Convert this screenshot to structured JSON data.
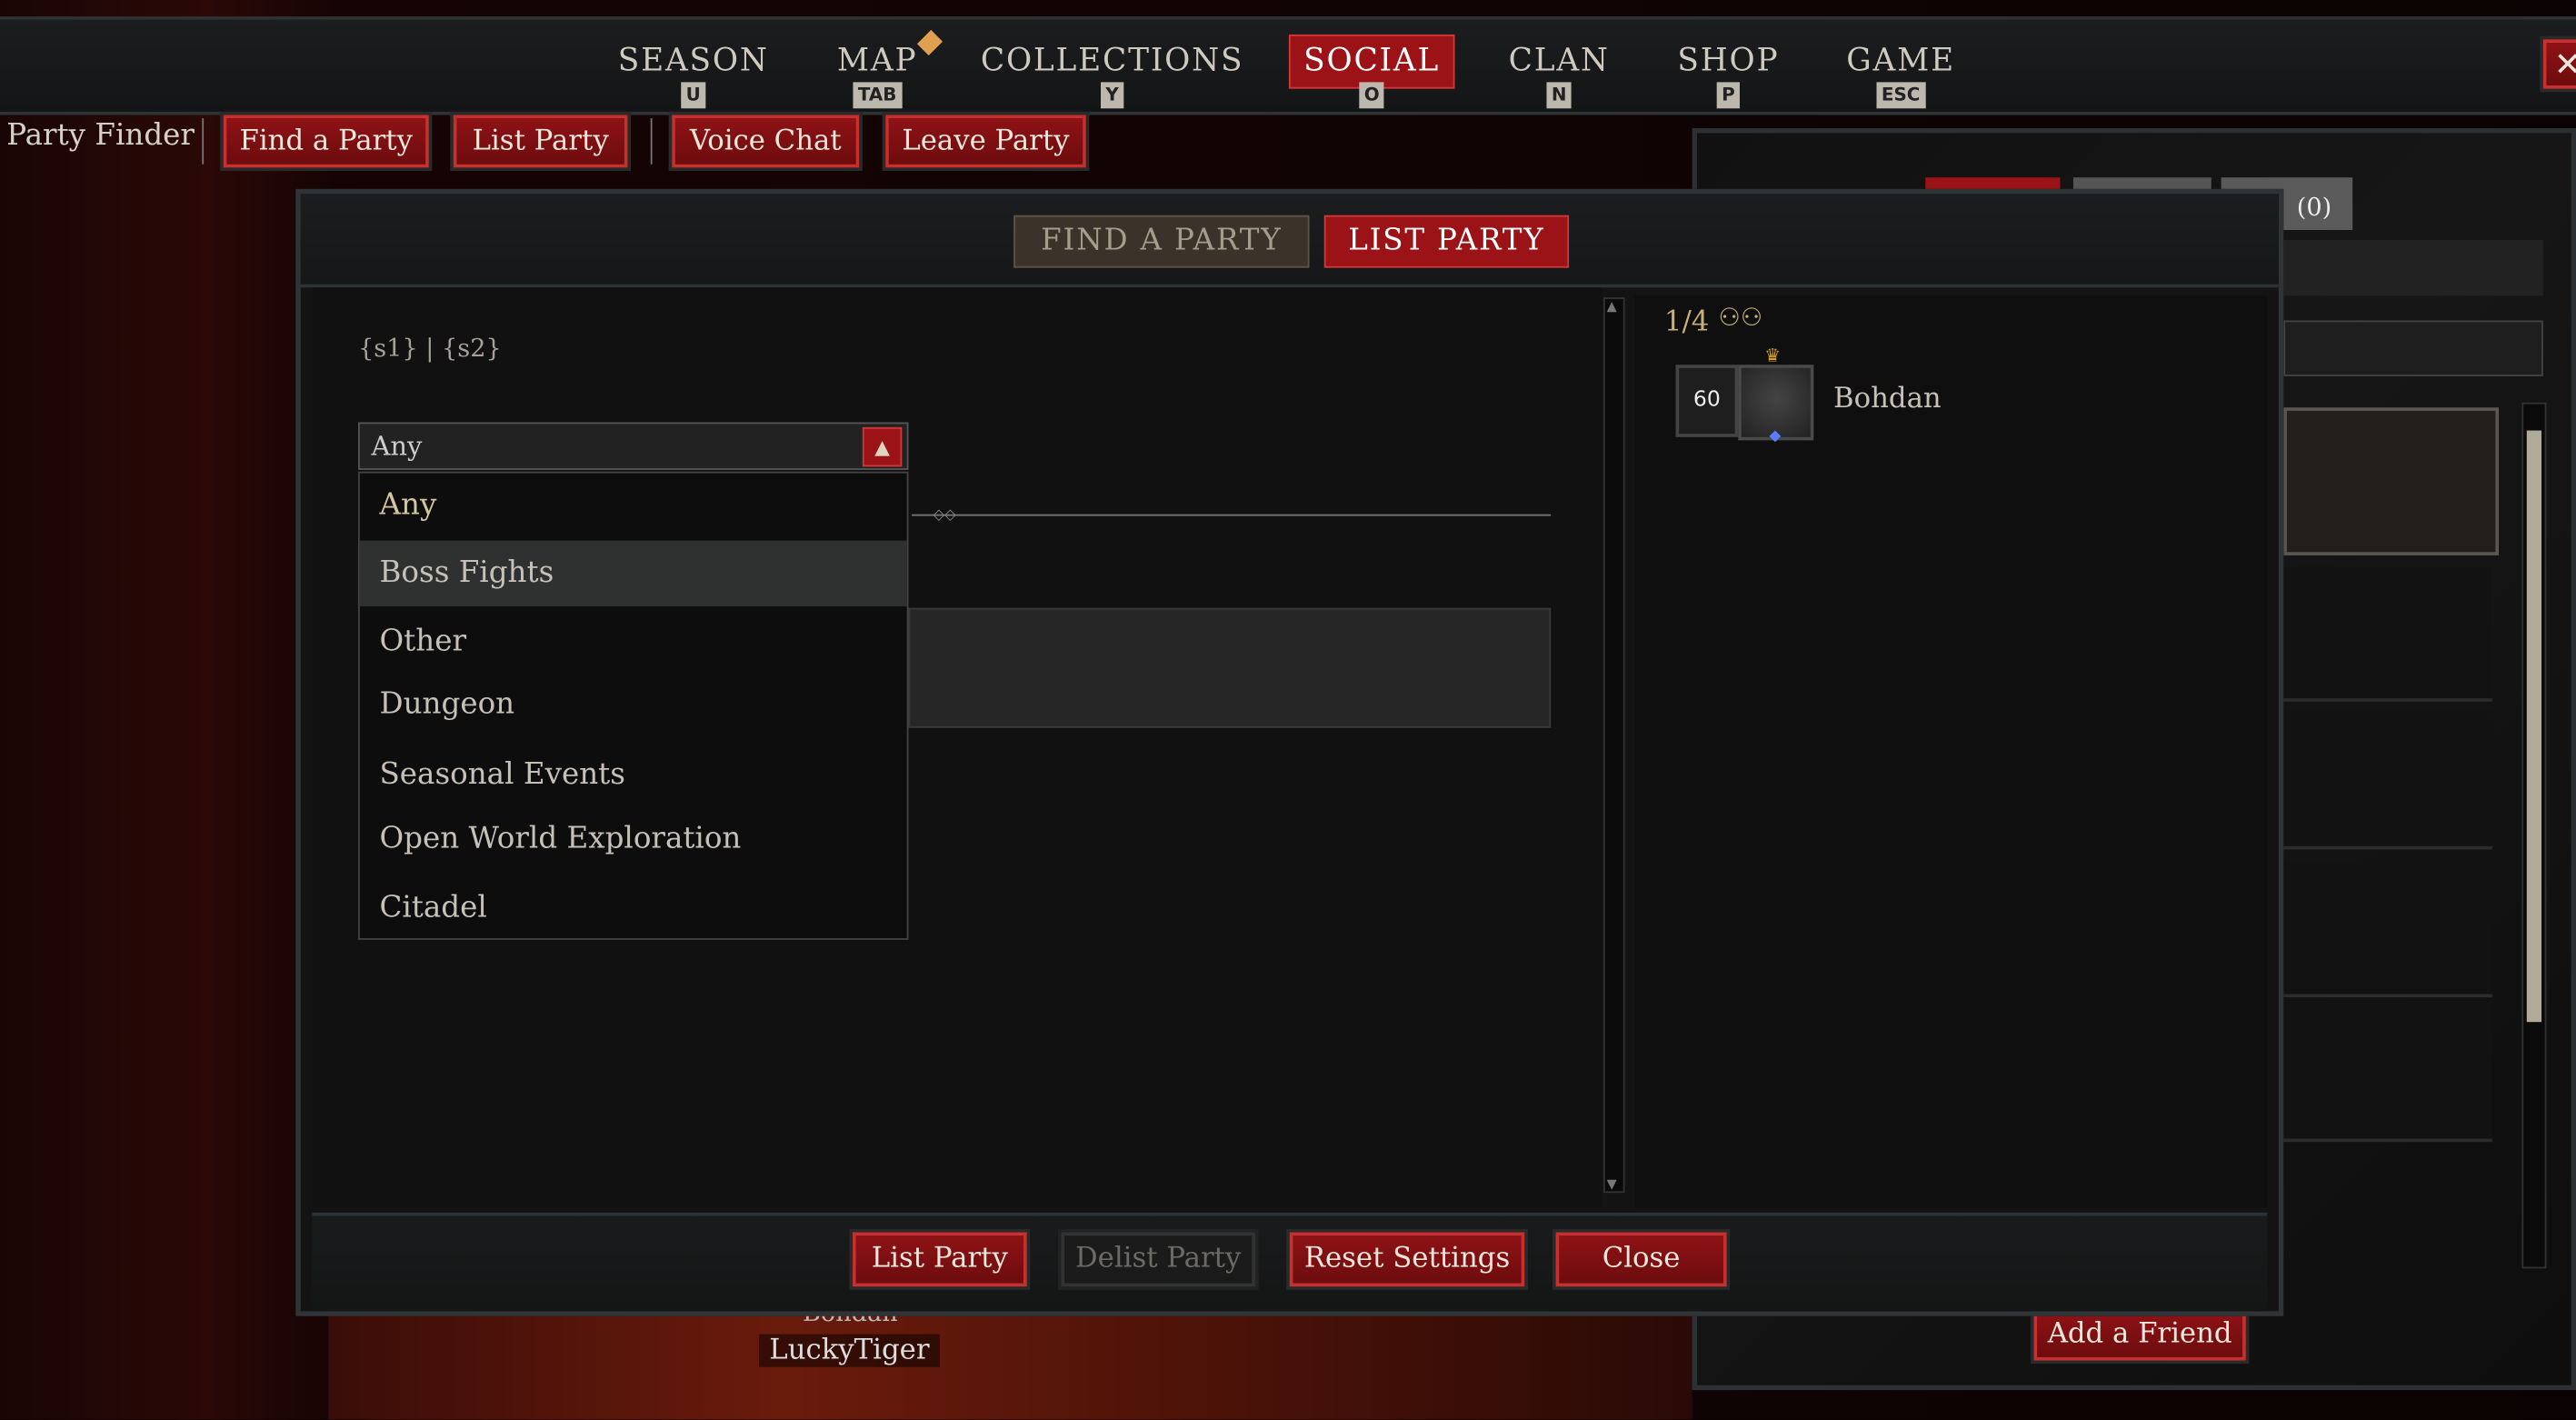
{
  "nav": {
    "items": [
      {
        "label": "SEASON",
        "key": "U"
      },
      {
        "label": "MAP",
        "key": "TAB"
      },
      {
        "label": "COLLECTIONS",
        "key": "Y"
      },
      {
        "label": "SOCIAL",
        "key": "O",
        "active": true
      },
      {
        "label": "CLAN",
        "key": "N"
      },
      {
        "label": "SHOP",
        "key": "P"
      },
      {
        "label": "GAME",
        "key": "ESC"
      }
    ],
    "close_icon": "close-x-icon"
  },
  "subbar": {
    "title": "Party Finder",
    "buttons": [
      "Find a Party",
      "List Party",
      "Voice Chat",
      "Leave Party"
    ]
  },
  "dialog": {
    "tabs": [
      {
        "label": "FIND A PARTY",
        "active": false
      },
      {
        "label": "LIST PARTY",
        "active": true
      }
    ],
    "placeholder_text": "{s1} | {s2}",
    "activity_select": {
      "value": "Any",
      "options": [
        "Any",
        "Boss Fights",
        "Other",
        "Dungeon",
        "Seasonal Events",
        "Open World Exploration",
        "Citadel"
      ],
      "highlighted": "Boss Fights"
    },
    "party": {
      "count": "1/4",
      "members": [
        {
          "level": "60",
          "name": "Bohdan",
          "leader": true
        }
      ]
    },
    "footer": {
      "list": "List Party",
      "delist": "Delist Party",
      "reset": "Reset Settings",
      "close": "Close"
    }
  },
  "social": {
    "tab_count": "(0)",
    "add_friend": "Add a Friend"
  },
  "scene": {
    "player_name": "Bohdan",
    "player_tag": "LuckyTiger"
  },
  "colors": {
    "accent_red": "#9c1317",
    "gold": "#c8b07a"
  }
}
